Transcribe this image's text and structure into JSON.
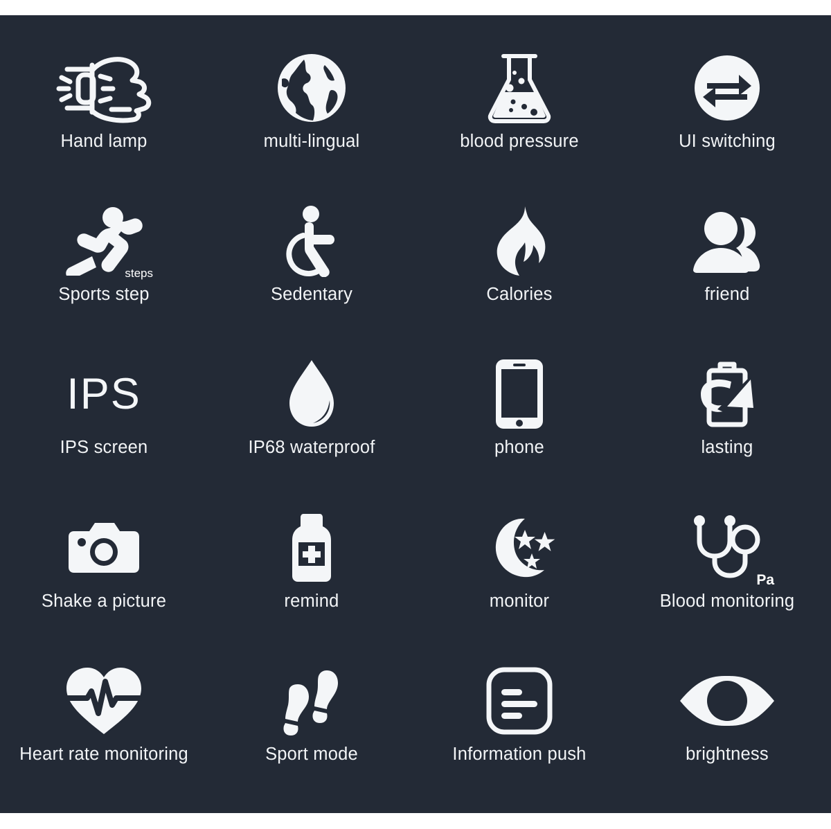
{
  "theme": {
    "background": "#232a36",
    "icon_color": "#f4f6f8",
    "label_color": "#f2f4f6",
    "page_color": "#ffffff"
  },
  "grid": {
    "columns": 4,
    "rows": 5
  },
  "features": [
    {
      "label": "Hand lamp",
      "icon": "fist-watch-light-icon"
    },
    {
      "label": "multi-lingual",
      "icon": "globe-icon"
    },
    {
      "label": "blood pressure",
      "icon": "flask-icon"
    },
    {
      "label": "UI switching",
      "icon": "swap-arrows-circle-icon"
    },
    {
      "label": "Sports step",
      "icon": "running-person-icon",
      "badge": "steps"
    },
    {
      "label": "Sedentary",
      "icon": "wheelchair-icon"
    },
    {
      "label": "Calories",
      "icon": "flame-icon"
    },
    {
      "label": "friend",
      "icon": "two-people-icon"
    },
    {
      "label": "IPS screen",
      "icon": "ips-text-icon",
      "glyph_text": "IPS"
    },
    {
      "label": "IP68 waterproof",
      "icon": "water-drop-icon"
    },
    {
      "label": "phone",
      "icon": "smartphone-icon"
    },
    {
      "label": "lasting",
      "icon": "battery-recharge-icon"
    },
    {
      "label": "Shake a picture",
      "icon": "camera-icon"
    },
    {
      "label": "remind",
      "icon": "medicine-bottle-icon"
    },
    {
      "label": "monitor",
      "icon": "moon-stars-icon"
    },
    {
      "label": "Blood monitoring",
      "icon": "stethoscope-icon",
      "badge": "Pa"
    },
    {
      "label": "Heart rate monitoring",
      "icon": "heart-pulse-icon"
    },
    {
      "label": "Sport mode",
      "icon": "footprints-icon"
    },
    {
      "label": "Information push",
      "icon": "message-lines-icon"
    },
    {
      "label": "brightness",
      "icon": "eye-icon"
    }
  ]
}
